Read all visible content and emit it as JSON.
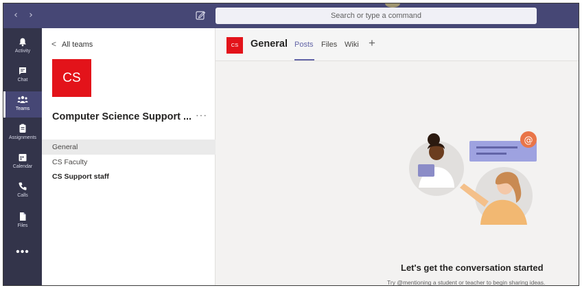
{
  "topbar": {
    "back_glyph": "‹",
    "forward_glyph": "›",
    "compose_icon": "compose-icon",
    "search_placeholder": "Search or type a command"
  },
  "rail": {
    "items": [
      {
        "label": "Activity",
        "icon": "bell-icon"
      },
      {
        "label": "Chat",
        "icon": "chat-icon"
      },
      {
        "label": "Teams",
        "icon": "teams-icon",
        "active": true
      },
      {
        "label": "Assignments",
        "icon": "assignments-icon"
      },
      {
        "label": "Calendar",
        "icon": "calendar-icon"
      },
      {
        "label": "Calls",
        "icon": "phone-icon"
      },
      {
        "label": "Files",
        "icon": "files-icon"
      }
    ],
    "more": "•••"
  },
  "team_panel": {
    "back_label": "All teams",
    "avatar_initials": "CS",
    "team_name": "Computer Science Support ...",
    "more": "···",
    "channels": [
      {
        "name": "General",
        "selected": true,
        "bold": false
      },
      {
        "name": "CS Faculty",
        "selected": false,
        "bold": false
      },
      {
        "name": "CS Support staff",
        "selected": false,
        "bold": true
      }
    ]
  },
  "main": {
    "channel_avatar": "CS",
    "channel_title": "General",
    "tabs": [
      {
        "label": "Posts",
        "active": true
      },
      {
        "label": "Files",
        "active": false
      },
      {
        "label": "Wiki",
        "active": false
      }
    ],
    "add_tab": "+",
    "empty_title": "Let's get the conversation started",
    "empty_subtitle": "Try @mentioning a student or teacher to begin sharing ideas."
  },
  "colors": {
    "topbar": "#464775",
    "rail": "#33344a",
    "accent": "#6264a7",
    "team_red": "#e3131a"
  }
}
